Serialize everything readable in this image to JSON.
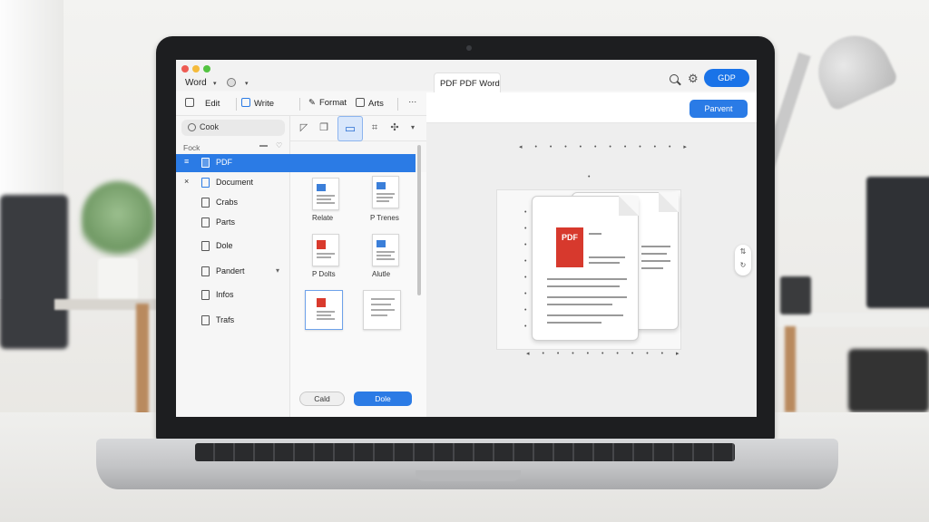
{
  "window": {
    "app_name": "Word",
    "tab_title": "PDF PDF Word",
    "header_button": "GDP"
  },
  "toolbar": {
    "items": [
      "Edit",
      "Write",
      "Format",
      "Arts"
    ],
    "more": "…"
  },
  "sidebar": {
    "search_value": "Cook",
    "section_label": "Fock",
    "items": [
      {
        "label": "PDF",
        "lead": "≡",
        "active": true
      },
      {
        "label": "Document",
        "lead": "×",
        "active": false
      },
      {
        "label": "Crabs",
        "lead": "",
        "active": false
      },
      {
        "label": "Parts",
        "lead": "",
        "active": false
      },
      {
        "label": "Dole",
        "lead": "",
        "active": false
      },
      {
        "label": "Pandert",
        "lead": "",
        "active": false
      },
      {
        "label": "Infos",
        "lead": "",
        "active": false
      },
      {
        "label": "Trafs",
        "lead": "",
        "active": false
      }
    ]
  },
  "files": {
    "thumbnails": [
      {
        "label": "Relate"
      },
      {
        "label": "P Trenes"
      },
      {
        "label": "P Dolts"
      },
      {
        "label": "Alutle"
      },
      {
        "label": ""
      },
      {
        "label": ""
      }
    ],
    "cancel_label": "Cald",
    "done_label": "Dole"
  },
  "preview": {
    "convert_button": "Parvent",
    "pdf_badge": "PDF"
  },
  "colors": {
    "accent": "#2b7be5",
    "pdf_red": "#d7392d",
    "laptop_body": "#1d1e20"
  }
}
